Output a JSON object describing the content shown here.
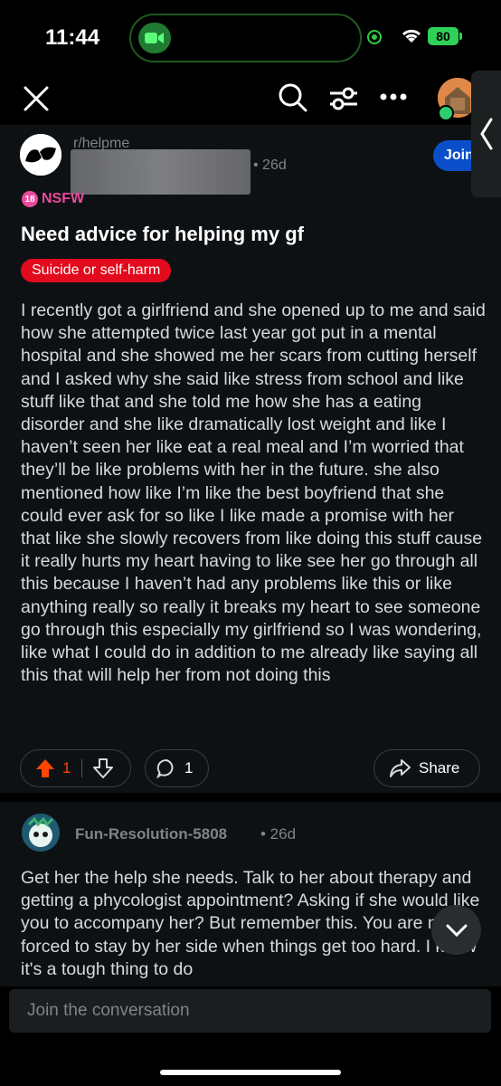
{
  "status_bar": {
    "time": "11:44",
    "battery": "80"
  },
  "post": {
    "subreddit": "r/helpme",
    "age": "• 26d",
    "join_label": "Join",
    "nsfw_badge": "18",
    "nsfw_label": "NSFW",
    "title": "Need advice for helping my gf",
    "flair": "Suicide or self-harm",
    "body": "I recently got a girlfriend and she opened up to me and said how she attempted twice last year got put in a mental hospital and she showed me her scars from cutting herself and I asked why she said like stress from school and like stuff like that and she told me how she has a eating disorder and she like dramatically lost weight and like I haven’t seen her like eat a real meal and I’m worried that they’ll be like problems with her in the future. she also mentioned how like I’m like the best boyfriend that she could ever ask for so like I like made a promise with her that like she slowly recovers from like doing this stuff cause it really hurts my heart having to like see her go through all this because I haven’t had any problems like this or like anything really so really it breaks my heart to see someone go through this especially my girlfriend so I was wondering, like what I could do in addition to me already like saying all this that will help her from not doing this",
    "vote_count": "1",
    "comment_count": "1",
    "share_label": "Share"
  },
  "comment": {
    "author": "Fun-Resolution-5808",
    "age": "• 26d",
    "body": "Get her the help she needs. Talk to her about therapy and getting a phycologist appointment? Asking if she would like you to accompany her? But remember this. You are not forced to stay by her side when things get too hard. I know it's a tough thing to do"
  },
  "composer": {
    "placeholder": "Join the conversation"
  },
  "colors": {
    "upvote": "#ff4500",
    "join": "#0a4ec9",
    "flair": "#e20a1c",
    "nsfw": "#ea4a9d",
    "background": "#0e1113"
  },
  "icons": [
    "close-icon",
    "search-icon",
    "filter-icon",
    "more-icon",
    "upvote-icon",
    "downvote-icon",
    "comment-icon",
    "share-icon",
    "chevron-down-icon",
    "chevron-left-icon"
  ]
}
